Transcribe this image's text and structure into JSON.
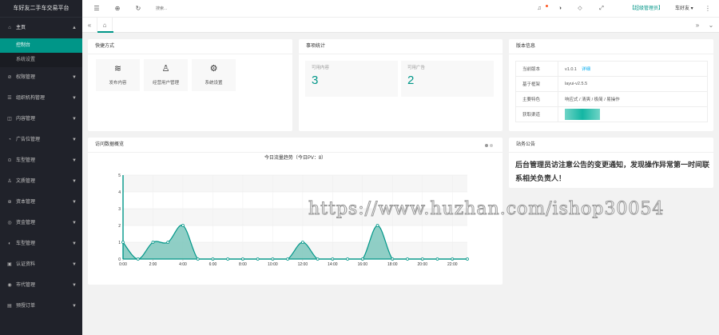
{
  "app": {
    "title": "车好友二手车交易平台"
  },
  "sidebar": {
    "items": [
      {
        "label": "主页",
        "icon": "home-icon",
        "glyph": "⌂",
        "open": true
      },
      {
        "label": "权限管理",
        "icon": "lock-icon",
        "glyph": "⊘"
      },
      {
        "label": "组织机构管理",
        "icon": "org-icon",
        "glyph": "☰"
      },
      {
        "label": "内容管理",
        "icon": "content-icon",
        "glyph": "◫"
      },
      {
        "label": "广告位管理",
        "icon": "ad-icon",
        "glyph": "◔"
      },
      {
        "label": "车型管理",
        "icon": "car-icon",
        "glyph": "⊙"
      },
      {
        "label": "文质管理",
        "icon": "doc-icon",
        "glyph": "♙"
      },
      {
        "label": "资本管理",
        "icon": "capital-icon",
        "glyph": "⊕"
      },
      {
        "label": "资金管理",
        "icon": "money-icon",
        "glyph": "◎"
      },
      {
        "label": "车型管理",
        "icon": "car-type-icon",
        "glyph": "◐"
      },
      {
        "label": "认证资料",
        "icon": "cert-icon",
        "glyph": "▣"
      },
      {
        "label": "市代管理",
        "icon": "agent-icon",
        "glyph": "◉"
      },
      {
        "label": "预授订单",
        "icon": "order-icon",
        "glyph": "▤"
      }
    ],
    "sub_items": [
      {
        "label": "控制台",
        "active": true
      },
      {
        "label": "系统设置",
        "active": false
      }
    ]
  },
  "header": {
    "search_placeholder": "搜索...",
    "role": "【超级管理员】",
    "user": "车好友 ▾"
  },
  "cards": {
    "quick": {
      "title": "快捷方式",
      "buttons": [
        {
          "label": "发布内容",
          "icon": "layers-icon",
          "glyph": "≋"
        },
        {
          "label": "经营用户管理",
          "icon": "user-icon",
          "glyph": "♙"
        },
        {
          "label": "系统设置",
          "icon": "gear-icon",
          "glyph": "⚙"
        }
      ]
    },
    "stats": {
      "title": "事项统计",
      "items": [
        {
          "label": "可用内容",
          "value": "3"
        },
        {
          "label": "可用广告",
          "value": "2"
        }
      ]
    },
    "version": {
      "title": "版本信息",
      "rows": [
        {
          "key": "当前版本",
          "value": "v1.0.1",
          "link": "详细"
        },
        {
          "key": "基于框架",
          "value": "layui-v2.5.5"
        },
        {
          "key": "主要特色",
          "value": "响应式 / 清爽 / 极简 / 易操作"
        },
        {
          "key": "获取渠道",
          "value": ""
        }
      ]
    },
    "visits": {
      "title": "访问数据概览",
      "chart_title": "今日流量趋势（今日PV：8）"
    },
    "notice": {
      "title": "站务公告",
      "text": "后台管理员访注意公告的变更通知，发现操作异常第一时间联系相关负责人！"
    }
  },
  "watermark": "https://www.huzhan.com/ishop30054",
  "colors": {
    "accent": "#009688",
    "sidebar_bg": "#20222a",
    "link": "#01aaed",
    "area_fill": "#7cc7bc"
  },
  "chart_data": {
    "type": "area",
    "title": "今日流量趋势（今日PV：8）",
    "x": [
      "0:00",
      "1:00",
      "2:00",
      "3:00",
      "4:00",
      "5:00",
      "6:00",
      "7:00",
      "8:00",
      "9:00",
      "10:00",
      "11:00",
      "12:00",
      "13:00",
      "14:00",
      "15:00",
      "16:00",
      "17:00",
      "18:00",
      "19:00",
      "20:00",
      "21:00",
      "22:00",
      "23:00"
    ],
    "x_tick_labels": [
      "0:00",
      "2:00",
      "4:00",
      "6:00",
      "8:00",
      "10:00",
      "12:00",
      "14:00",
      "16:00",
      "18:00",
      "20:00",
      "22:00"
    ],
    "series": [
      {
        "values": [
          1,
          0,
          1,
          1,
          2,
          0,
          0,
          0,
          0,
          0,
          0,
          0,
          1,
          0,
          0,
          0,
          0,
          2,
          0,
          0,
          0,
          0,
          0,
          0
        ]
      }
    ],
    "y_ticks": [
      0,
      1,
      2,
      3,
      4,
      5
    ],
    "ylim": [
      0,
      5
    ],
    "grid": true
  }
}
